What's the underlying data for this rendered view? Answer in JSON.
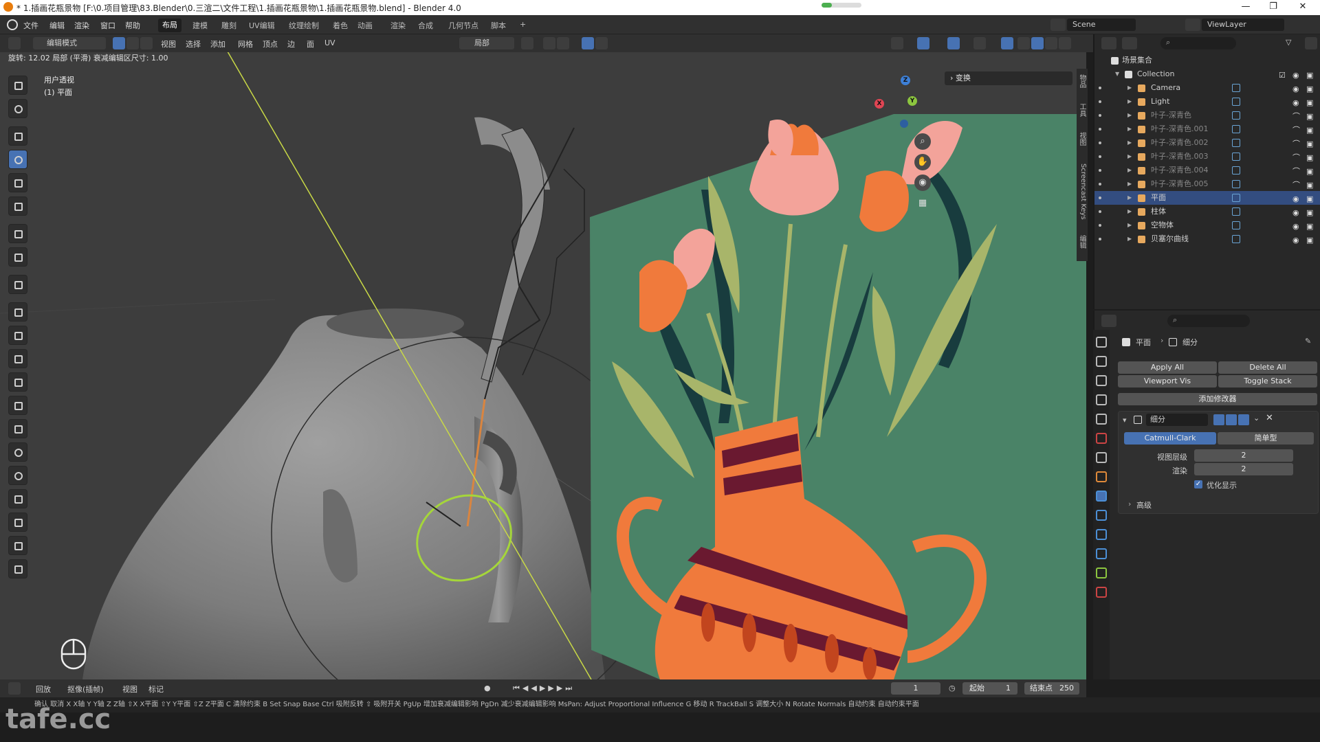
{
  "title_bar": {
    "text": "* 1.插画花瓶景物 [F:\\0.项目管理\\83.Blender\\0.三渲二\\文件工程\\1.插画花瓶景物\\1.插画花瓶景物.blend] - Blender 4.0",
    "minimize": "—",
    "maximize": "❐",
    "close": "✕",
    "loading_progress": 0.25
  },
  "menu": [
    "文件",
    "编辑",
    "渲染",
    "窗口",
    "帮助"
  ],
  "workspaces": [
    "布局",
    "建模",
    "雕刻",
    "UV编辑",
    "纹理绘制",
    "着色",
    "动画",
    "渲染",
    "合成",
    "几何节点",
    "脚本"
  ],
  "workspace_active": "布局",
  "workspace_add": "+",
  "scene": {
    "scene_name": "Scene",
    "view_layer": "ViewLayer"
  },
  "header3d": {
    "mode": "编辑模式",
    "menus": [
      "视图",
      "选择",
      "添加",
      "网格",
      "顶点",
      "边",
      "面",
      "UV"
    ],
    "pivot": "局部"
  },
  "status_text": "旋转: 12.02 局部 (平滑) 衰减编辑区尺寸: 1.00",
  "viewport": {
    "view_name": "用户透视",
    "object_name": "(1) 平面"
  },
  "transform_panel": "变换",
  "n_tabs": [
    "物品",
    "工具",
    "视图",
    "Screencast Keys",
    "编辑"
  ],
  "gizmo": {
    "x": "X",
    "y": "Y",
    "z": "Z"
  },
  "outliner": {
    "root": "场景集合",
    "collection": "Collection",
    "items": [
      {
        "name": "Camera",
        "color": "#e7a95e",
        "dim": false,
        "selected": false
      },
      {
        "name": "Light",
        "color": "#e7a95e",
        "dim": false,
        "selected": false
      },
      {
        "name": "叶子-深青色",
        "color": "#e7a95e",
        "dim": true,
        "selected": false
      },
      {
        "name": "叶子-深青色.001",
        "color": "#e7a95e",
        "dim": true,
        "selected": false
      },
      {
        "name": "叶子-深青色.002",
        "color": "#e7a95e",
        "dim": true,
        "selected": false
      },
      {
        "name": "叶子-深青色.003",
        "color": "#e7a95e",
        "dim": true,
        "selected": false
      },
      {
        "name": "叶子-深青色.004",
        "color": "#e7a95e",
        "dim": true,
        "selected": false
      },
      {
        "name": "叶子-深青色.005",
        "color": "#e7a95e",
        "dim": true,
        "selected": false
      },
      {
        "name": "平面",
        "color": "#e7a95e",
        "dim": false,
        "selected": true
      },
      {
        "name": "柱体",
        "color": "#e7a95e",
        "dim": false,
        "selected": false
      },
      {
        "name": "空物体",
        "color": "#e7a95e",
        "dim": false,
        "selected": false
      },
      {
        "name": "贝塞尔曲线",
        "color": "#e7a95e",
        "dim": false,
        "selected": false
      }
    ]
  },
  "properties": {
    "breadcrumb_object": "平面",
    "breadcrumb_sep": "›",
    "breadcrumb_modifier": "细分",
    "apply_all": "Apply All",
    "delete_all": "Delete All",
    "viewport_vis": "Viewport Vis",
    "toggle_stack": "Toggle Stack",
    "add_modifier": "添加修改器",
    "modifier_name": "细分",
    "catmull": "Catmull-Clark",
    "simple": "简单型",
    "levels_label": "视图层级",
    "levels_value": "2",
    "render_label": "渲染",
    "render_value": "2",
    "optimal_display": "优化显示",
    "advanced": "高级"
  },
  "timeline": {
    "playback": "回放",
    "keying": "抠像(插帧)",
    "view": "视图",
    "marker": "标记",
    "current_frame": "1",
    "start_label": "起始",
    "start_value": "1",
    "end_label": "结束点",
    "end_value": "250"
  },
  "keybar": "确认  取消  X X轴  Y Y轴  Z Z轴  ⇧X X平面  ⇧Y Y平面  ⇧Z Z平面  C 清除约束  B Set Snap Base  Ctrl 吸附反转  ⇧ 吸附开关  PgUp 增加衰减编辑影响  PgDn 减少衰减编辑影响  MsPan: Adjust Proportional Influence  G 移动  R TrackBall  S 调整大小  N Rotate Normals  自动约束  自动约束平面",
  "watermark": "tafe.cc"
}
